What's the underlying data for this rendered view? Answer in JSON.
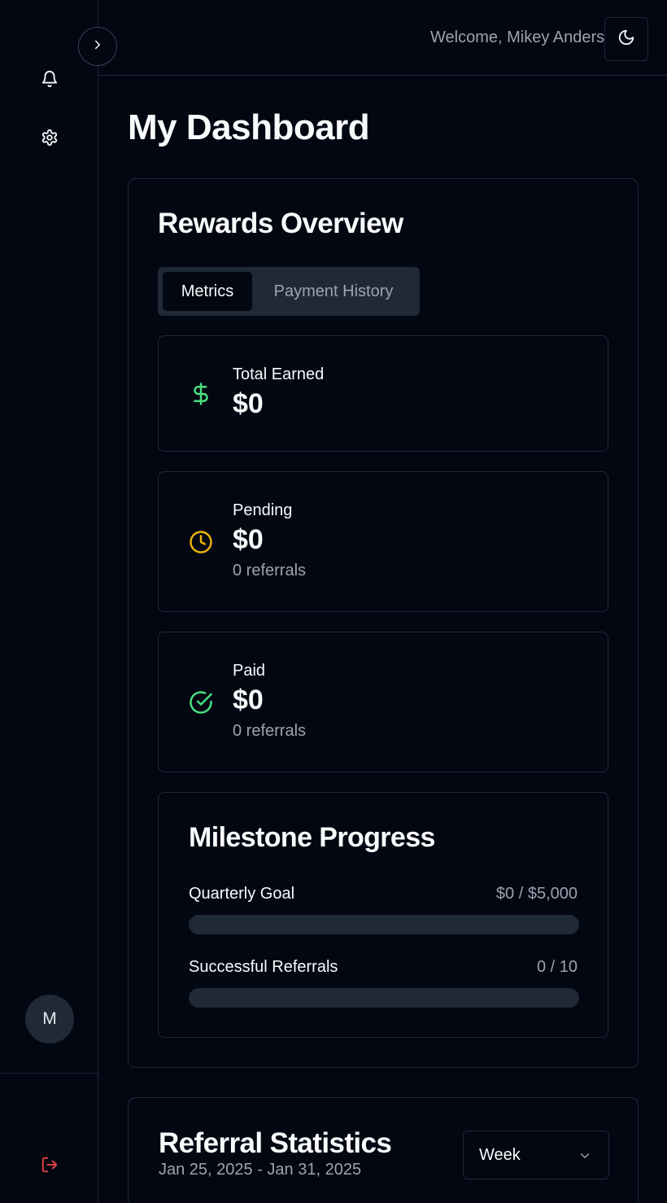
{
  "header": {
    "welcome": "Welcome, Mikey Anderson"
  },
  "page": {
    "title": "My Dashboard"
  },
  "sidebar": {
    "avatar_initial": "M",
    "icons": [
      "bell-icon",
      "gear-icon",
      "logout-icon"
    ]
  },
  "rewards": {
    "title": "Rewards Overview",
    "tabs": [
      {
        "label": "Metrics",
        "active": true
      },
      {
        "label": "Payment History",
        "active": false
      }
    ],
    "metrics": [
      {
        "label": "Total Earned",
        "value": "$0",
        "sub": "",
        "icon": "dollar-icon",
        "color": "#4ade80"
      },
      {
        "label": "Pending",
        "value": "$0",
        "sub": "0 referrals",
        "icon": "clock-icon",
        "color": "#eab308"
      },
      {
        "label": "Paid",
        "value": "$0",
        "sub": "0 referrals",
        "icon": "check-circle-icon",
        "color": "#4ade80"
      }
    ]
  },
  "milestones": {
    "title": "Milestone Progress",
    "items": [
      {
        "label": "Quarterly Goal",
        "value": "$0 / $5,000",
        "progress": 0
      },
      {
        "label": "Successful Referrals",
        "value": "0 / 10",
        "progress": 0
      }
    ]
  },
  "stats": {
    "title": "Referral Statistics",
    "range": "Jan 25, 2025 - Jan 31, 2025",
    "period": "Week"
  },
  "colors": {
    "background": "#030712",
    "border": "#1e293b",
    "muted_text": "#9ca3af",
    "logout": "#ef4444"
  }
}
